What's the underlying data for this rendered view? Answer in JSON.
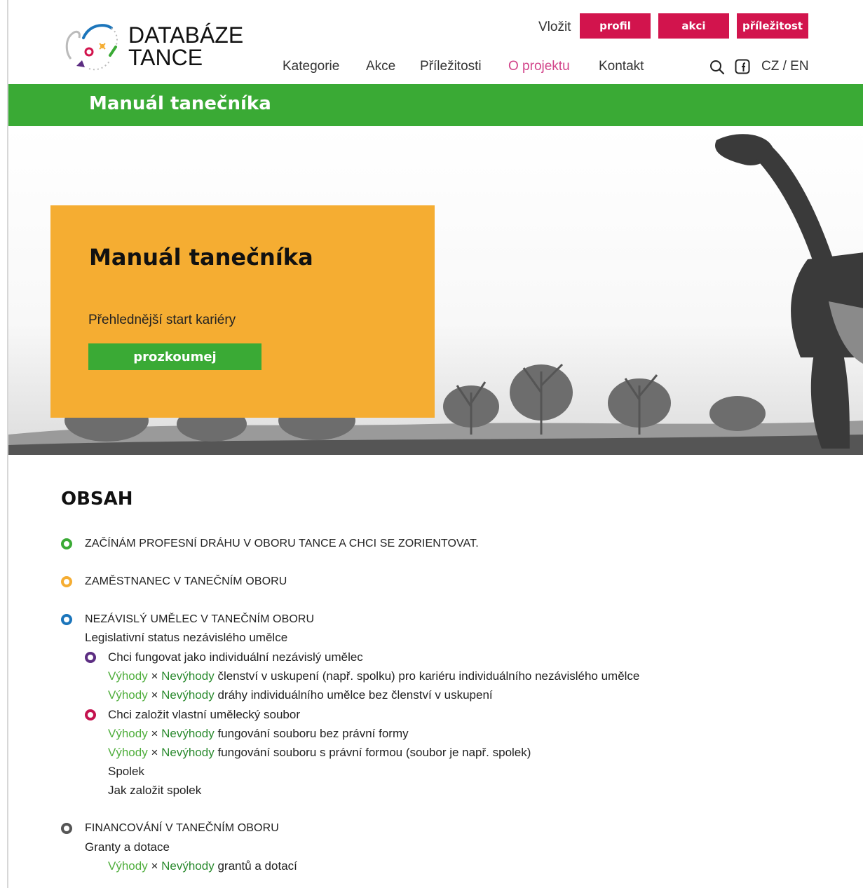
{
  "header": {
    "logo_line1": "DATABÁZE",
    "logo_line2": "TANCE",
    "insert_label": "Vložit",
    "insert_buttons": [
      "profil",
      "akci",
      "příležitost"
    ],
    "nav": [
      "Kategorie",
      "Akce",
      "Příležitosti",
      "O projektu",
      "Kontakt"
    ],
    "active_nav": "O projektu",
    "lang": "CZ / EN"
  },
  "section_bar": {
    "title": "Manuál tanečníka"
  },
  "hero": {
    "title": "Manuál tanečníka",
    "subtitle": "Přehlednější start kariéry",
    "button": "prozkoumej"
  },
  "toc": {
    "heading": "OBSAH",
    "item1": "ZAČÍNÁM PROFESNÍ DRÁHU V OBORU TANCE A CHCI SE ZORIENTOVAT.",
    "item2": "ZAMĚSTNANEC V TANEČNÍM OBORU",
    "item3": "NEZÁVISLÝ UMĚLEC V TANEČNÍM OBORU",
    "item3_status": "Legislativní status nezávislého umělce",
    "item3_a": "Chci fungovat jako individuální nezávislý umělec",
    "item3_a1": "členství v uskupení (např. spolku) pro kariéru individuálního nezávislého umělce",
    "item3_a2": "dráhy individuálního umělce bez členství v uskupení",
    "item3_b": "Chci založit vlastní umělecký soubor",
    "item3_b1": "fungování souboru bez právní formy",
    "item3_b2": "fungování souboru s právní formou (soubor je např. spolek)",
    "item3_b3": "Spolek",
    "item3_b4": "Jak založit spolek",
    "item4": "FINANCOVÁNÍ V TANEČNÍM OBORU",
    "item4_sub": "Granty a dotace",
    "item4_sub1": "grantů a dotací",
    "advantages": "Výhody",
    "times": "×",
    "disadvantages": "Nevýhody"
  },
  "colors": {
    "green": "#3aaa35",
    "orange": "#f5ad32",
    "pink": "#d2144d",
    "blue": "#1b75bb",
    "purple": "#5c2d82",
    "magenta": "#c4134f",
    "grey": "#555555"
  }
}
